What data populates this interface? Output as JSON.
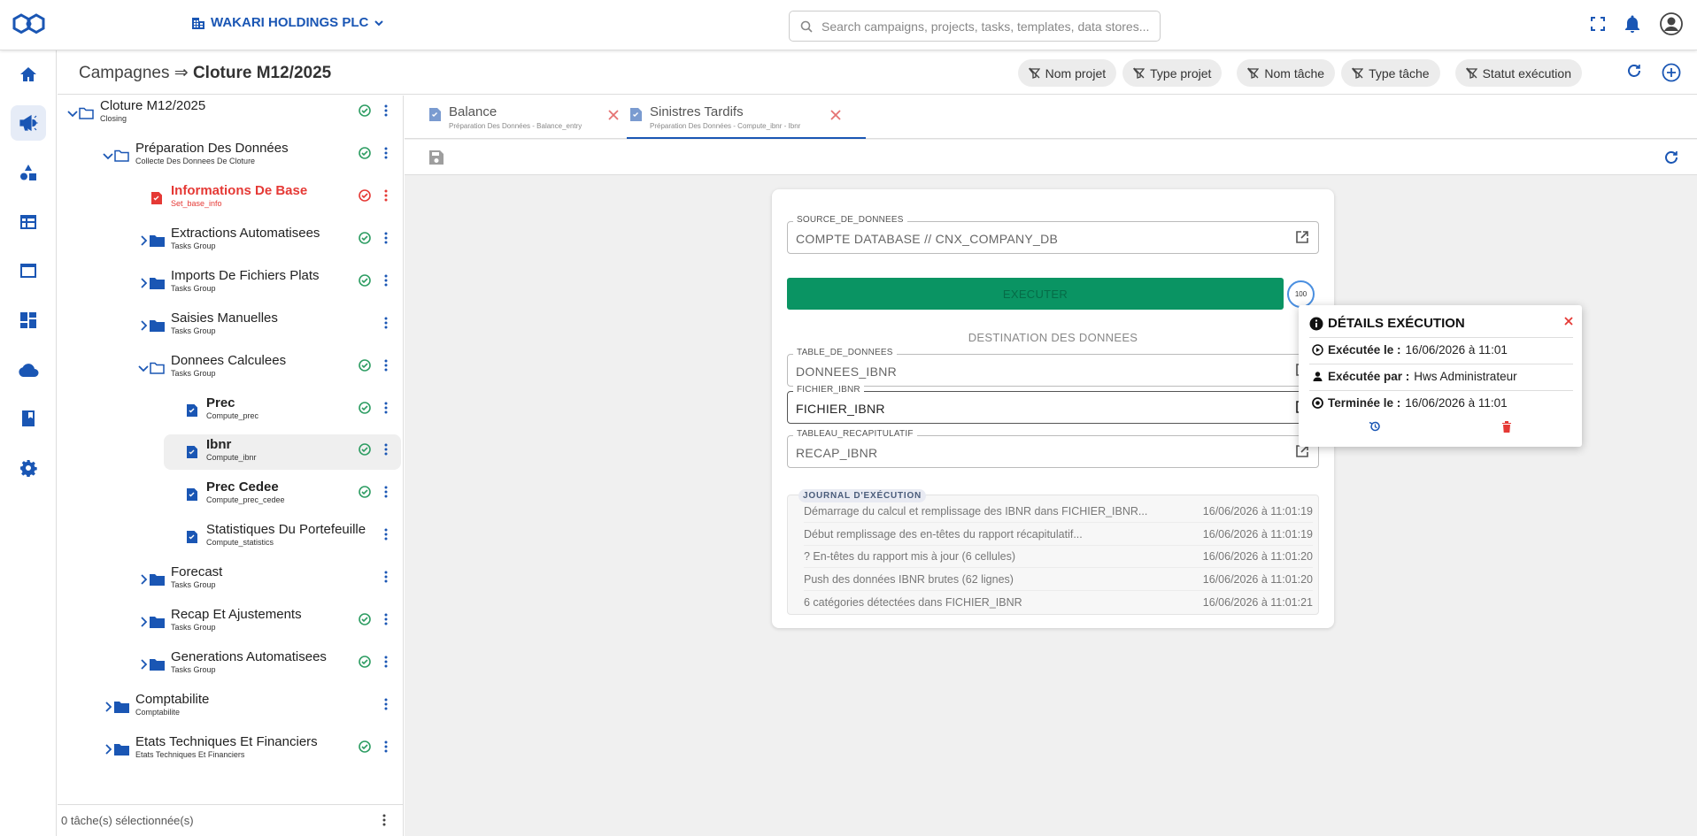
{
  "colors": {
    "brand": "#1a56b4",
    "success": "#2e9d63",
    "error": "#e53935",
    "execute_button": "#0a9463"
  },
  "company": {
    "name": "WAKARI HOLDINGS PLC"
  },
  "search": {
    "placeholder": "Search campaigns, projects, tasks, templates, data stores..."
  },
  "breadcrumb": {
    "root": "Campagnes",
    "separator": "⇒",
    "current": "Cloture M12/2025"
  },
  "filters": [
    "Nom projet",
    "Type projet",
    "Nom tâche",
    "Type tâche",
    "Statut exécution"
  ],
  "tree": {
    "nodes": [
      {
        "label": "Cloture M12/2025",
        "sublabel": "Closing",
        "icon": "folder-outline-icon",
        "expanded": true,
        "status": "ok"
      },
      {
        "label": "Préparation Des Données",
        "sublabel": "Collecte Des Donnees De Cloture",
        "icon": "folder-outline-icon",
        "expanded": true,
        "status": "ok"
      },
      {
        "label": "Informations De Base",
        "sublabel": "Set_base_info",
        "icon": "task-error-icon",
        "status": "error"
      },
      {
        "label": "Extractions Automatisees",
        "sublabel": "Tasks Group",
        "icon": "folder-icon",
        "expanded": false,
        "status": "ok"
      },
      {
        "label": "Imports De Fichiers Plats",
        "sublabel": "Tasks Group",
        "icon": "folder-icon",
        "expanded": false,
        "status": "ok"
      },
      {
        "label": "Saisies Manuelles",
        "sublabel": "Tasks Group",
        "icon": "folder-icon",
        "expanded": false,
        "status": "none"
      },
      {
        "label": "Donnees Calculees",
        "sublabel": "Tasks Group",
        "icon": "folder-outline-icon",
        "expanded": true,
        "status": "ok"
      },
      {
        "label": "Prec",
        "sublabel": "Compute_prec",
        "icon": "task-icon",
        "status": "ok"
      },
      {
        "label": "Ibnr",
        "sublabel": "Compute_ibnr",
        "icon": "task-icon",
        "status": "ok"
      },
      {
        "label": "Prec Cedee",
        "sublabel": "Compute_prec_cedee",
        "icon": "task-icon",
        "status": "ok"
      },
      {
        "label": "Statistiques Du Portefeuille",
        "sublabel": "Compute_statistics",
        "icon": "task-icon",
        "status": "none"
      },
      {
        "label": "Forecast",
        "sublabel": "Tasks Group",
        "icon": "folder-icon",
        "expanded": false,
        "status": "none"
      },
      {
        "label": "Recap Et Ajustements",
        "sublabel": "Tasks Group",
        "icon": "folder-icon",
        "expanded": false,
        "status": "ok"
      },
      {
        "label": "Generations Automatisees",
        "sublabel": "Tasks Group",
        "icon": "folder-icon",
        "expanded": false,
        "status": "ok"
      },
      {
        "label": "Comptabilite",
        "sublabel": "Comptabilite",
        "icon": "folder-icon",
        "expanded": false,
        "status": "none"
      },
      {
        "label": "Etats Techniques Et Financiers",
        "sublabel": "Etats Techniques Et Financiers",
        "icon": "folder-icon",
        "expanded": false,
        "status": "ok"
      }
    ],
    "footer": "0 tâche(s) sélectionnée(s)"
  },
  "tabs": [
    {
      "title": "Balance",
      "subtitle": "Préparation Des Données - Balance_entry"
    },
    {
      "title": "Sinistres Tardifs",
      "subtitle": "Préparation Des Données - Compute_ibnr - Ibnr"
    }
  ],
  "form": {
    "source": {
      "label": "SOURCE_DE_DONNEES",
      "value": "COMPTE DATABASE // CNX_COMPANY_DB"
    },
    "execute_label": "EXECUTER",
    "progress": "100",
    "destination_title": "DESTINATION DES DONNEES",
    "table": {
      "label": "TABLE_DE_DONNEES",
      "value": "DONNEES_IBNR"
    },
    "fichier": {
      "label": "FICHIER_IBNR",
      "value": "FICHIER_IBNR"
    },
    "recap": {
      "label": "TABLEAU_RECAPITULATIF",
      "value": "RECAP_IBNR"
    }
  },
  "journal": {
    "title": "JOURNAL D'EXÉCUTION",
    "rows": [
      {
        "message": "Démarrage du calcul et remplissage des IBNR dans FICHIER_IBNR...",
        "time": "16/06/2026 à 11:01:19"
      },
      {
        "message": "Début remplissage des en-têtes du rapport récapitulatif...",
        "time": "16/06/2026 à 11:01:19"
      },
      {
        "message": "? En-têtes du rapport mis à jour (6 cellules)",
        "time": "16/06/2026 à 11:01:20"
      },
      {
        "message": "Push des données IBNR brutes (62 lignes)",
        "time": "16/06/2026 à 11:01:20"
      },
      {
        "message": "6 catégories détectées dans FICHIER_IBNR",
        "time": "16/06/2026 à 11:01:21"
      }
    ]
  },
  "details": {
    "title": "DÉTAILS EXÉCUTION",
    "executed_at_label": "Exécutée le :",
    "executed_at": "16/06/2026 à 11:01",
    "executed_by_label": "Exécutée par :",
    "executed_by": "Hws Administrateur",
    "finished_at_label": "Terminée le :",
    "finished_at": "16/06/2026 à 11:01"
  }
}
